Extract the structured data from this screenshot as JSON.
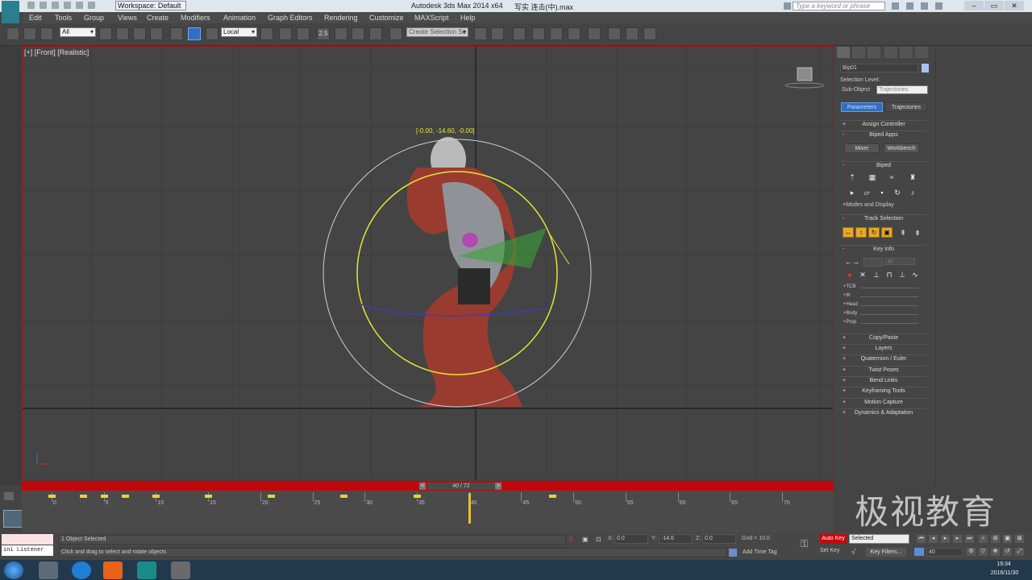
{
  "titlebar": {
    "workspace": "Workspace: Default",
    "app_title": "Autodesk 3ds Max  2014 x64",
    "file_title": "写实 连击(中).max",
    "search_placeholder": "Type a keyword or phrase"
  },
  "menu": [
    "Edit",
    "Tools",
    "Group",
    "Views",
    "Create",
    "Modifiers",
    "Animation",
    "Graph Editors",
    "Rendering",
    "Customize",
    "MAXScript",
    "Help"
  ],
  "toolbar": {
    "filter": "All",
    "coord_system": "Local",
    "snap_label": "2.5",
    "selection_set": "Create Selection Se"
  },
  "viewport": {
    "label": "[+] [Front] [Realistic]",
    "gizmo_readout": "[-0.00, -14.60, -0.00]"
  },
  "command_panel": {
    "object_name": "Bip01",
    "selection_level_label": "Selection Level:",
    "subobject_label": "Sub-Object",
    "subobject_value": "Trajectories",
    "tab_parameters": "Parameters",
    "tab_trajectories": "Trajectories",
    "assign_controller": "Assign Controller",
    "biped_apps": "Biped Apps",
    "mixer": "Mixer",
    "workbench": "Workbench",
    "biped": "Biped",
    "modes_display": "Modes and Display",
    "track_selection": "Track Selection",
    "key_info": "Key Info",
    "key_frame": "40",
    "key_lines": [
      "TCB",
      "IK",
      "Head",
      "Body",
      "Prop"
    ],
    "rollouts": [
      "Copy/Paste",
      "Layers",
      "Quaternion / Euler",
      "Twist Poses",
      "Bend Links",
      "Keyframing Tools",
      "Motion Capture",
      "Dynamics & Adaptation"
    ]
  },
  "timeline": {
    "slider_label": "40 / 72",
    "current_frame": 40,
    "total_frames": 72,
    "ticks": [
      "0",
      "5",
      "10",
      "15",
      "20",
      "25",
      "30",
      "35",
      "40",
      "45",
      "50",
      "55",
      "60",
      "65",
      "70"
    ],
    "keys": [
      0,
      3,
      5,
      7,
      10,
      15,
      21,
      28,
      35,
      48
    ]
  },
  "status": {
    "selection": "1 Object Selected",
    "hint": "Click and drag to select and rotate objects",
    "mini_listener": "ini Listener",
    "x_label": "X:",
    "x_value": "0.0",
    "y_label": "Y:",
    "y_value": "-14.6",
    "z_label": "Z:",
    "z_value": "0.0",
    "grid": "Grid = 10.0",
    "add_time_tag": "Add Time Tag",
    "auto_key": "Auto Key",
    "selected": "Selected",
    "set_key": "Set Key",
    "key_filters": "Key Filters...",
    "frame_field": "40"
  },
  "taskbar": {
    "time": "19:34",
    "date": "2016/11/30"
  },
  "watermark": "极视教育",
  "colors": {
    "accent_red": "#c0080b",
    "selection_blue": "#2f6ec4",
    "key_yellow": "#e8d33a"
  }
}
